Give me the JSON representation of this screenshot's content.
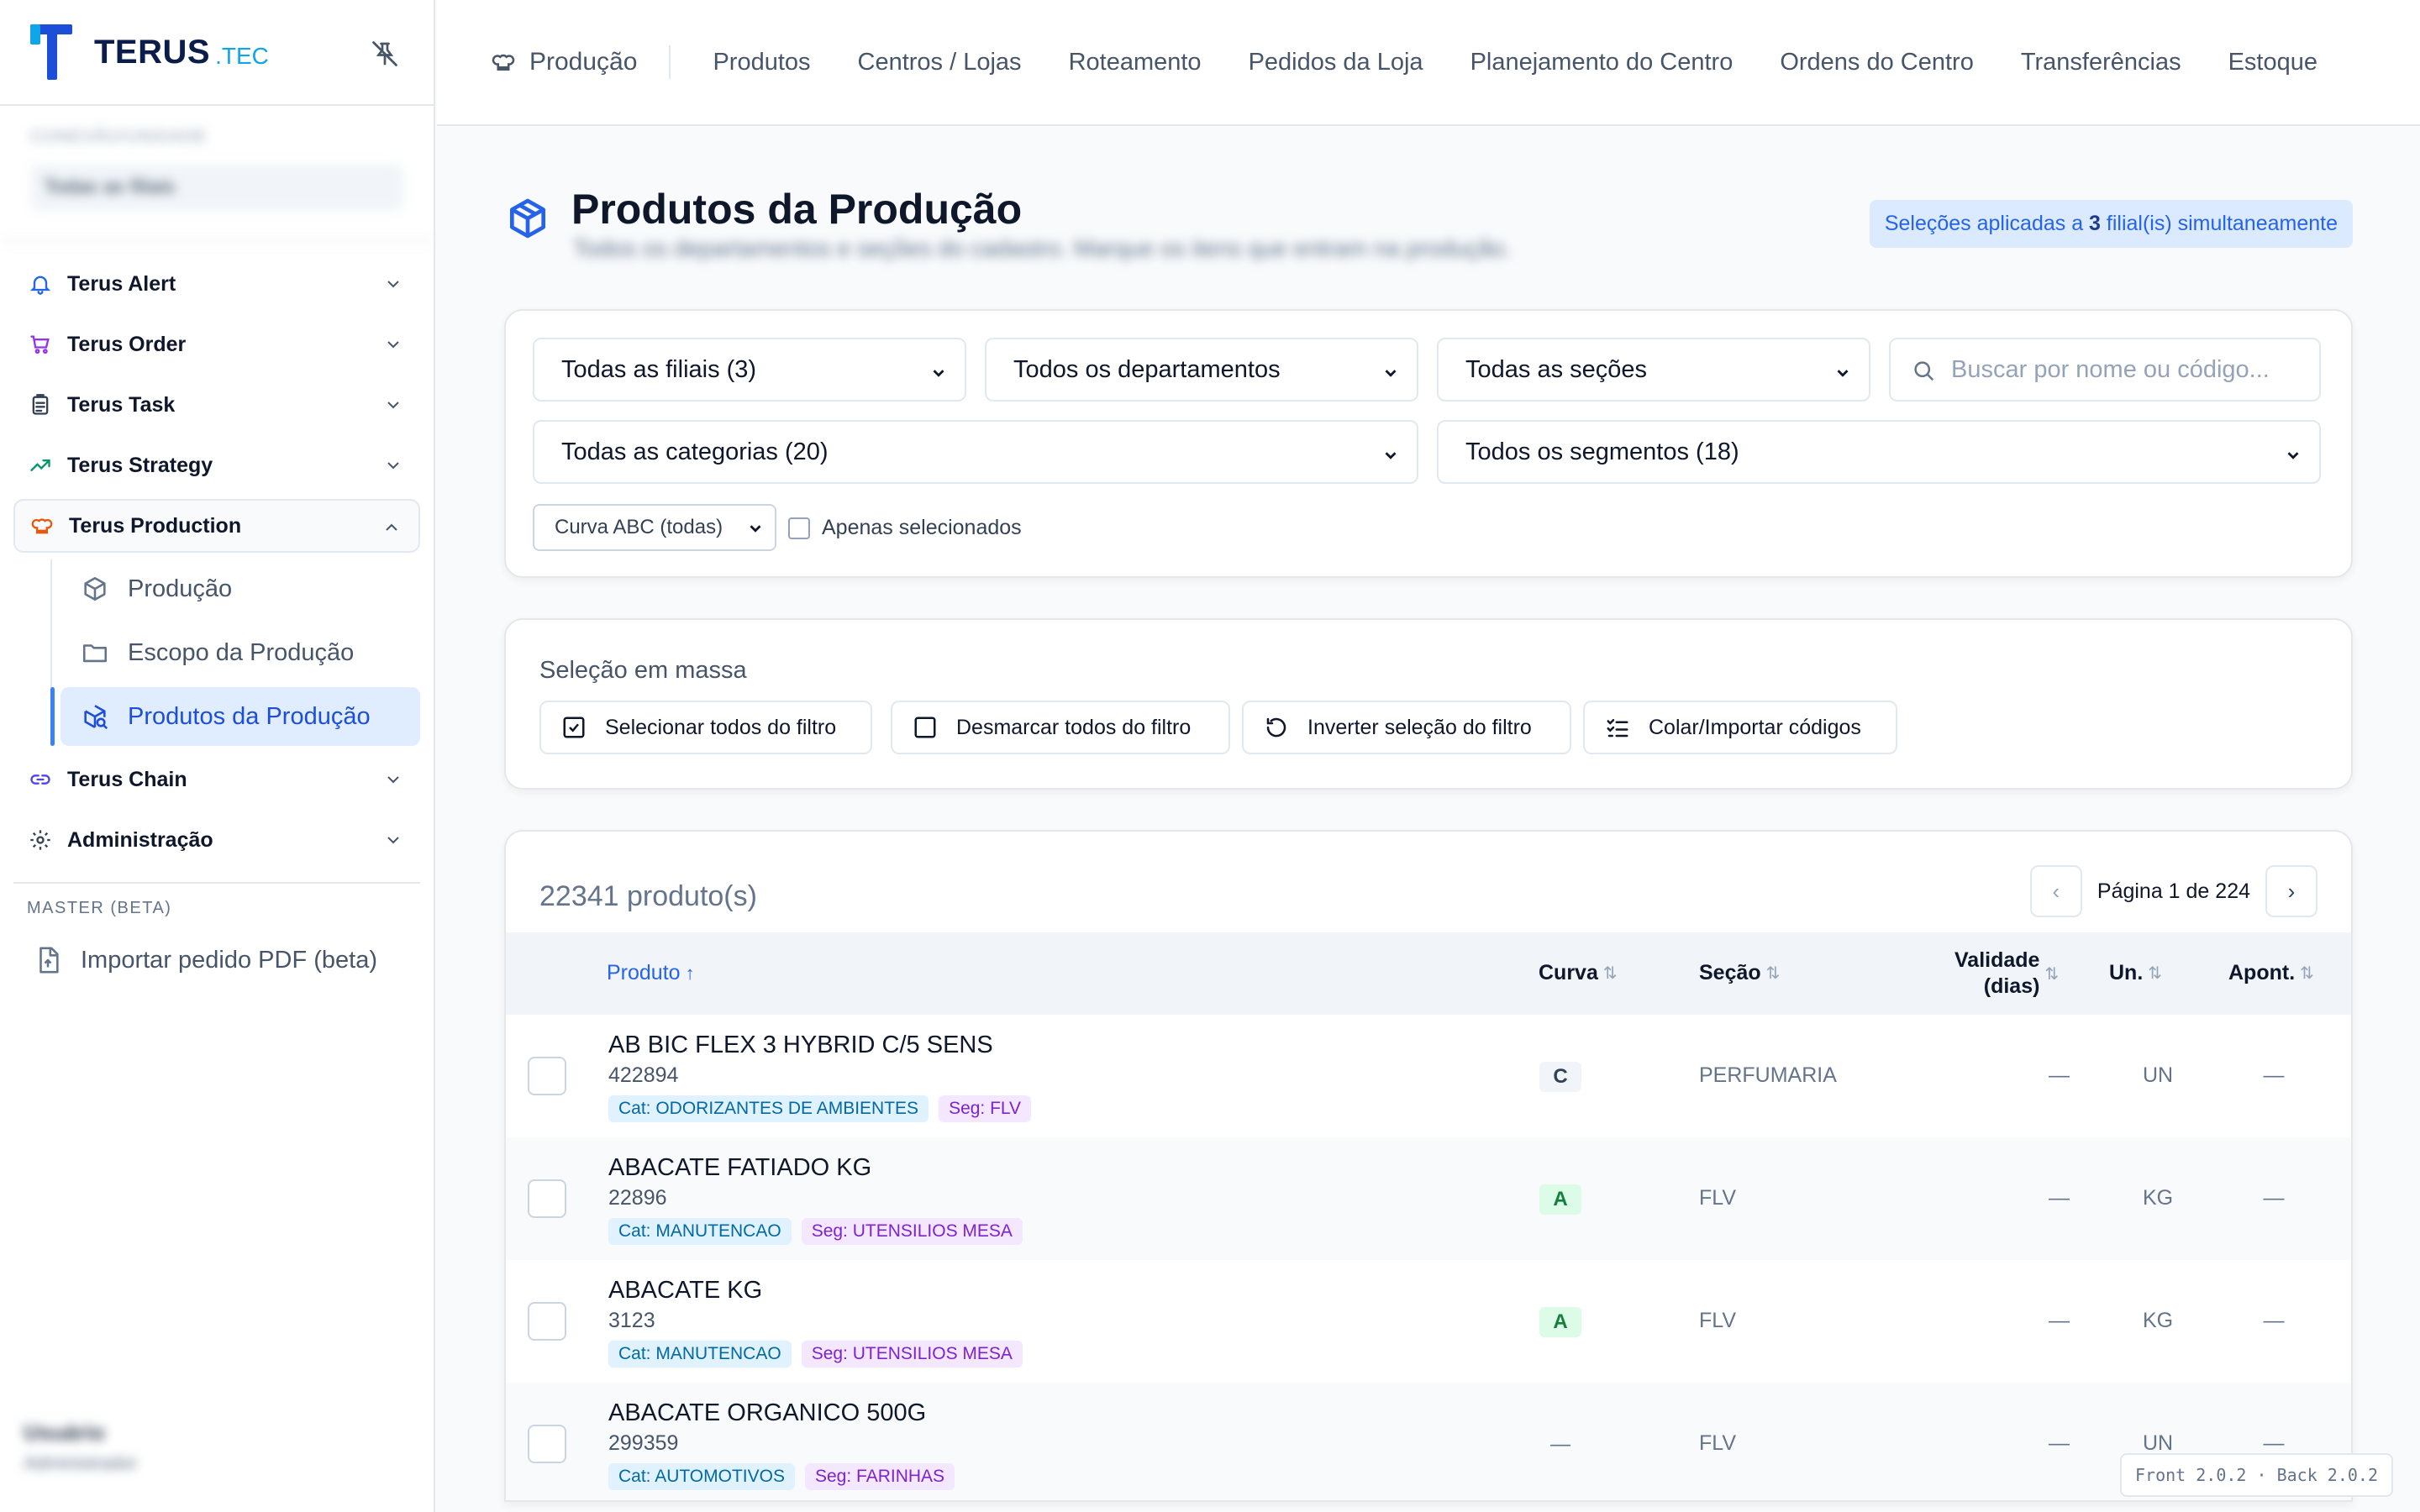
{
  "brand": {
    "name": "TERUS",
    "suffix": ".TEC"
  },
  "unit": {
    "label": "CONEXÃO/UNIDADE",
    "value": "Todas as filiais"
  },
  "sidebar": {
    "items": [
      {
        "label": "Terus Alert",
        "icon": "bell-icon"
      },
      {
        "label": "Terus Order",
        "icon": "cart-icon"
      },
      {
        "label": "Terus Task",
        "icon": "clipboard-icon"
      },
      {
        "label": "Terus Strategy",
        "icon": "trending-up-icon"
      },
      {
        "label": "Terus Production",
        "icon": "chef-hat-icon"
      },
      {
        "label": "Terus Chain",
        "icon": "link-icon"
      },
      {
        "label": "Administração",
        "icon": "gear-icon"
      }
    ],
    "production_sub": [
      {
        "label": "Produção",
        "icon": "box-icon"
      },
      {
        "label": "Escopo da Produção",
        "icon": "folder-icon"
      },
      {
        "label": "Produtos da Produção",
        "icon": "box-search-icon"
      }
    ],
    "master_label": "MASTER (BETA)",
    "import_label": "Importar pedido PDF (beta)",
    "user": {
      "name": "Usuário",
      "role": "Administrador"
    }
  },
  "topnav": {
    "home": "Produção",
    "tabs": [
      "Produtos",
      "Centros / Lojas",
      "Roteamento",
      "Pedidos da Loja",
      "Planejamento do Centro",
      "Ordens do Centro",
      "Transferências",
      "Estoque"
    ]
  },
  "page": {
    "title": "Produtos da Produção",
    "subtitle": "Todos os departamentos e seções do cadastro. Marque os itens que entram na produção.",
    "selection_badge_pre": "Seleções aplicadas a ",
    "selection_badge_num": "3",
    "selection_badge_post": " filial(is) simultaneamente"
  },
  "filters": {
    "filiais": "Todas as filiais (3)",
    "departamentos": "Todos os departamentos",
    "secoes": "Todas as seções",
    "search_placeholder": "Buscar por nome ou código...",
    "categorias": "Todas as categorias (20)",
    "segmentos": "Todos os segmentos (18)",
    "curva": "Curva ABC (todas)",
    "apenas_selecionados": "Apenas selecionados"
  },
  "bulk": {
    "title": "Seleção em massa",
    "select_all": "Selecionar todos do filtro",
    "unselect_all": "Desmarcar todos do filtro",
    "invert": "Inverter seleção do filtro",
    "paste": "Colar/Importar códigos"
  },
  "table": {
    "count": "22341 produto(s)",
    "page_info": "Página 1 de 224",
    "prev": "‹",
    "next": "›",
    "headers": {
      "produto": "Produto",
      "produto_sort": "↑",
      "curva": "Curva",
      "secao": "Seção",
      "validade_1": "Validade",
      "validade_2": "(dias)",
      "un": "Un.",
      "apont": "Apont.",
      "sort_icon": "⇅"
    },
    "rows": [
      {
        "name": "AB BIC FLEX 3 HYBRID C/5 SENS",
        "code": "422894",
        "cat": "Cat: ODORIZANTES DE AMBIENTES",
        "seg": "Seg: FLV",
        "curva": "C",
        "secao": "PERFUMARIA",
        "validade": "—",
        "un": "UN",
        "apont": "—"
      },
      {
        "name": "ABACATE FATIADO KG",
        "code": "22896",
        "cat": "Cat: MANUTENCAO",
        "seg": "Seg: UTENSILIOS MESA",
        "curva": "A",
        "secao": "FLV",
        "validade": "—",
        "un": "KG",
        "apont": "—"
      },
      {
        "name": "ABACATE KG",
        "code": "3123",
        "cat": "Cat: MANUTENCAO",
        "seg": "Seg: UTENSILIOS MESA",
        "curva": "A",
        "secao": "FLV",
        "validade": "—",
        "un": "KG",
        "apont": "—"
      },
      {
        "name": "ABACATE ORGANICO 500G",
        "code": "299359",
        "cat": "Cat: AUTOMOTIVOS",
        "seg": "Seg: FARINHAS",
        "curva": "—",
        "secao": "FLV",
        "validade": "—",
        "un": "UN",
        "apont": "—"
      }
    ]
  },
  "version": "Front 2.0.2 · Back 2.0.2",
  "colors": {
    "accent": "#2563eb",
    "brand": "#1d4ed8",
    "active_bg": "#e0ecff",
    "curva_a": "#dcfce7"
  }
}
